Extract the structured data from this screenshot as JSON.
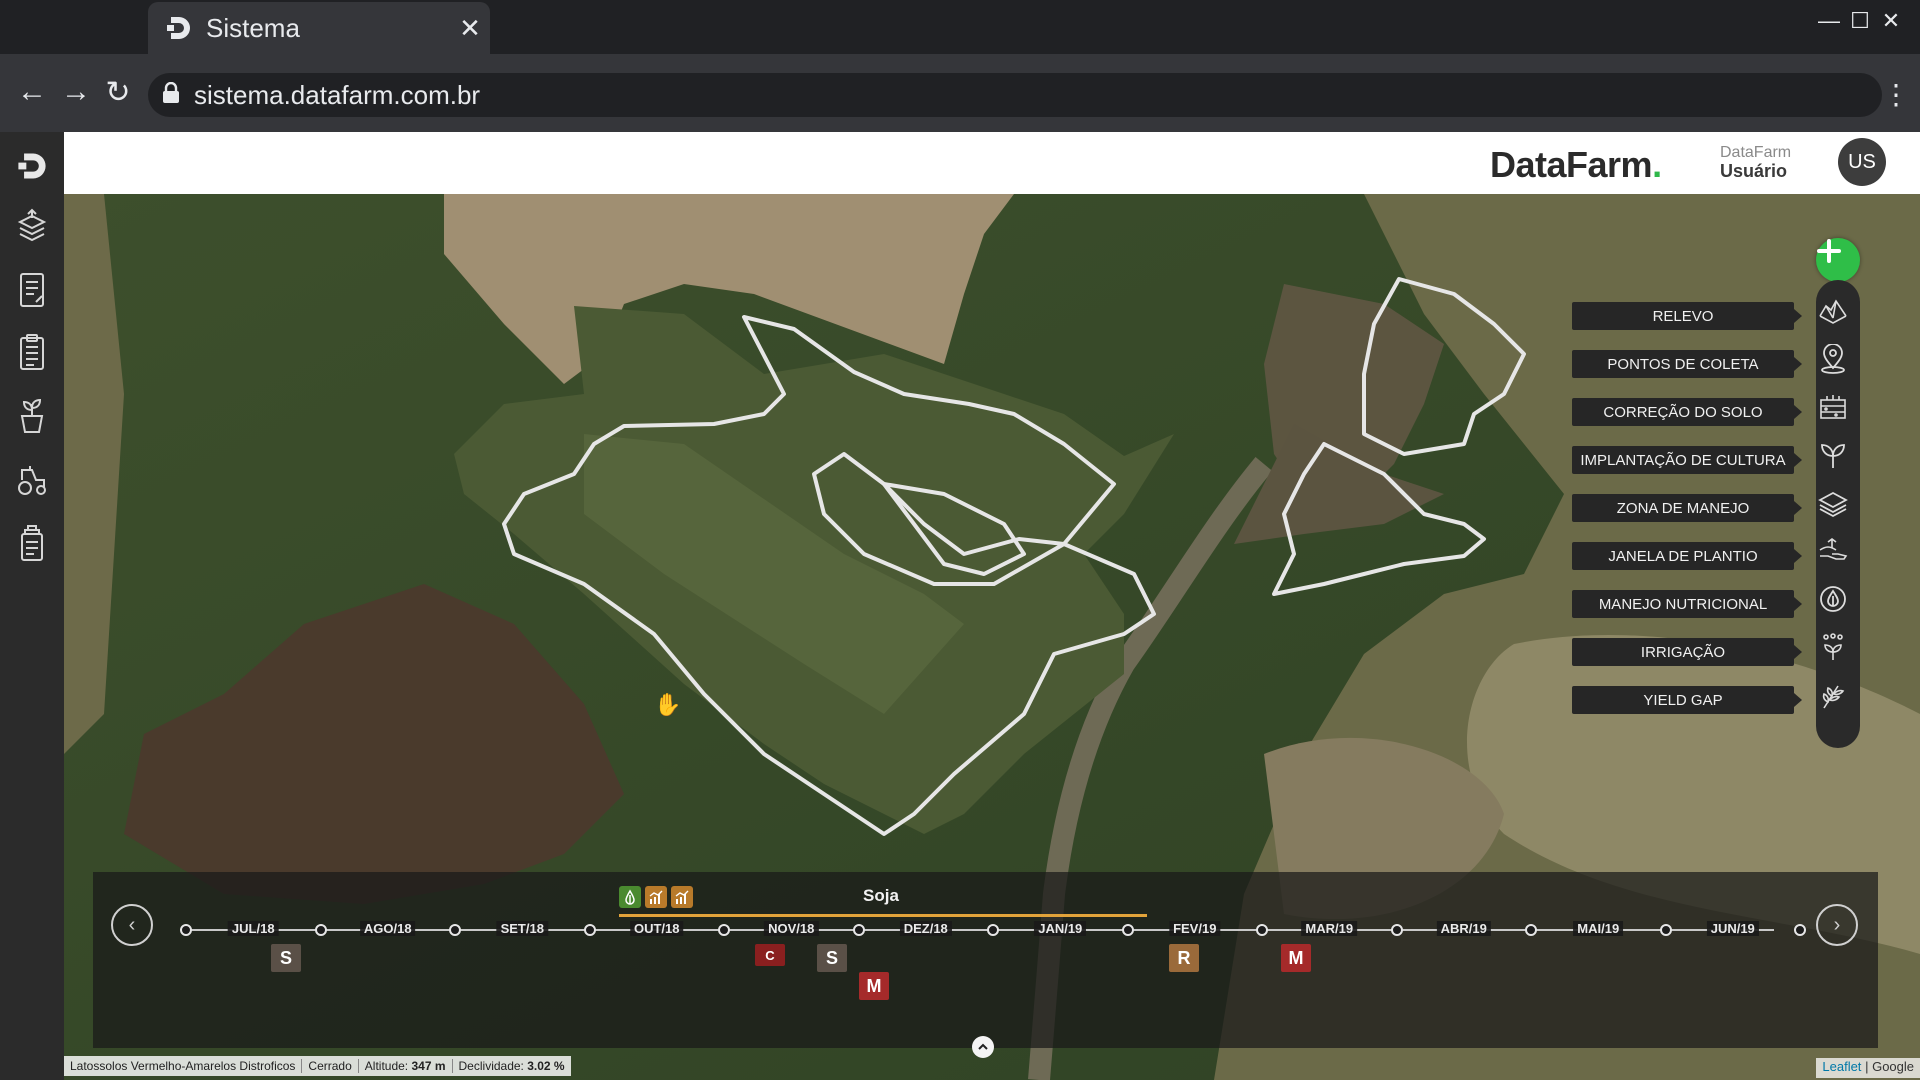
{
  "browser": {
    "tab_title": "Sistema",
    "url": "sistema.datafarm.com.br"
  },
  "sidebar": {
    "items": [
      {
        "icon": "datafarm-logo-icon"
      },
      {
        "icon": "layers-stack-icon"
      },
      {
        "icon": "report-edit-icon"
      },
      {
        "icon": "clipboard-list-icon"
      },
      {
        "icon": "plant-cup-icon"
      },
      {
        "icon": "tractor-icon"
      },
      {
        "icon": "document-stack-icon"
      }
    ]
  },
  "header": {
    "logo_text": "DataFarm",
    "logo_dot": ".",
    "company": "DataFarm",
    "user": "Usuário",
    "avatar": "US"
  },
  "layers": {
    "items": [
      {
        "label": "RELEVO",
        "icon": "relief-icon"
      },
      {
        "label": "PONTOS DE COLETA",
        "icon": "location-pin-icon"
      },
      {
        "label": "CORREÇÃO DO SOLO",
        "icon": "soil-correction-icon"
      },
      {
        "label": "IMPLANTAÇÃO DE CULTURA",
        "icon": "seedling-icon"
      },
      {
        "label": "ZONA DE MANEJO",
        "icon": "layers-icon"
      },
      {
        "label": "JANELA DE PLANTIO",
        "icon": "planting-hand-icon"
      },
      {
        "label": "MANEJO NUTRICIONAL",
        "icon": "nutrient-drop-icon"
      },
      {
        "label": "IRRIGAÇÃO",
        "icon": "irrigation-icon"
      },
      {
        "label": "YIELD GAP",
        "icon": "yield-plant-icon"
      }
    ],
    "accent": "#2fbe48"
  },
  "timeline": {
    "crop": "Soja",
    "months": [
      "JUL/18",
      "AGO/18",
      "SET/18",
      "OUT/18",
      "NOV/18",
      "DEZ/18",
      "JAN/19",
      "FEV/19",
      "MAR/19",
      "ABR/19",
      "MAI/19",
      "JUN/19"
    ],
    "events": [
      {
        "label": "S",
        "color": "#5a5047"
      },
      {
        "label": "C",
        "color": "#8a1f1f"
      },
      {
        "label": "S",
        "color": "#5a5047"
      },
      {
        "label": "M",
        "color": "#a52a2a"
      },
      {
        "label": "R",
        "color": "#9a6a3a"
      },
      {
        "label": "M",
        "color": "#a52a2a"
      }
    ]
  },
  "status": {
    "soil": "Latossolos Vermelho-Amarelos Distroficos",
    "biome": "Cerrado",
    "altitude_label": "Altitude:",
    "altitude": "347 m",
    "slope_label": "Declividade:",
    "slope": "3.02 %"
  },
  "attribution": {
    "leaflet": "Leaflet",
    "separator": "|",
    "google": "Google"
  }
}
